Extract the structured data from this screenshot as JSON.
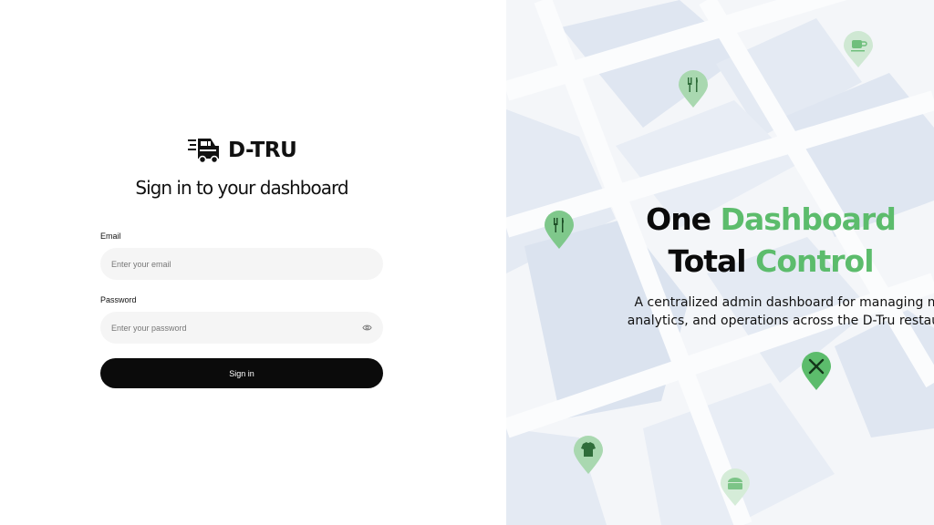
{
  "brand": {
    "name": "D-TRU"
  },
  "signin": {
    "title": "Sign in to your dashboard",
    "email_label": "Email",
    "email_placeholder": "Enter your email",
    "email_value": "",
    "password_label": "Password",
    "password_placeholder": "Enter your password",
    "password_value": "",
    "button_label": "Sign in"
  },
  "hero": {
    "line1_a": "One",
    "line1_b": "Dashboard",
    "line2_a": "Total",
    "line2_b": "Control",
    "description_line1": "A centralized admin dashboard for managing merchan",
    "description_line2": "analytics, and operations across the D-Tru restaurant net"
  },
  "colors": {
    "accent_green": "#5cbc6c",
    "button_dark": "#0b0b0b",
    "input_bg": "#f5f5f5",
    "map_bg": "#edf1f6"
  },
  "map_pins": [
    {
      "icon": "coffee-cup-icon"
    },
    {
      "icon": "fork-knife-icon"
    },
    {
      "icon": "fork-knife-icon"
    },
    {
      "icon": "tools-icon"
    },
    {
      "icon": "shirt-icon"
    },
    {
      "icon": "shop-icon"
    }
  ]
}
